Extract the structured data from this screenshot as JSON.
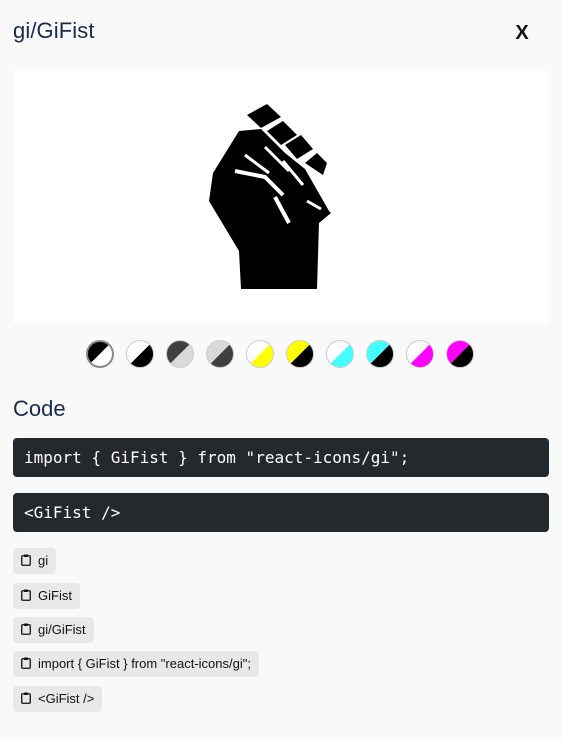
{
  "header": {
    "title": "gi/GiFist",
    "close_label": "X"
  },
  "preview": {
    "icon": "fist-icon",
    "icon_color": "#000000",
    "background": "#ffffff"
  },
  "swatches": [
    {
      "name": "black-white",
      "a": "#ffffff",
      "b": "#000000",
      "selected": true
    },
    {
      "name": "white-black",
      "a": "#000000",
      "b": "#ffffff"
    },
    {
      "name": "gray-dark",
      "a": "#d9d9d9",
      "b": "#404040"
    },
    {
      "name": "dark-gray",
      "a": "#404040",
      "b": "#d9d9d9"
    },
    {
      "name": "yellow-white",
      "a": "#ffff00",
      "b": "#ffffff"
    },
    {
      "name": "yellow-black",
      "a": "#000000",
      "b": "#ffff00"
    },
    {
      "name": "cyan-white",
      "a": "#44ffff",
      "b": "#ffffff"
    },
    {
      "name": "cyan-black",
      "a": "#000000",
      "b": "#44ffff"
    },
    {
      "name": "magenta-white",
      "a": "#ff00ff",
      "b": "#ffffff"
    },
    {
      "name": "magenta-black",
      "a": "#000000",
      "b": "#ff00ff"
    }
  ],
  "code": {
    "section_title": "Code",
    "import_line": "import { GiFist } from \"react-icons/gi\";",
    "jsx_line": "<GiFist />"
  },
  "copy_buttons": [
    {
      "label": "gi"
    },
    {
      "label": "GiFist"
    },
    {
      "label": "gi/GiFist"
    },
    {
      "label": "import { GiFist } from \"react-icons/gi\";"
    },
    {
      "label": "<GiFist />"
    }
  ],
  "colors": {
    "code_bg": "#24292e",
    "title": "#1b2a4a",
    "button_bg": "#e8e8e8"
  }
}
